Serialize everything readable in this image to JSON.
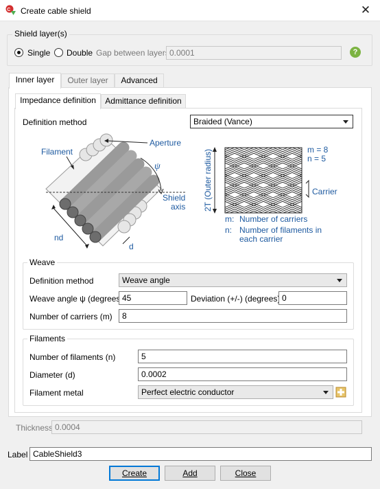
{
  "window": {
    "title": "Create cable shield",
    "app_icon": "cadfeko-icon",
    "close_label": "✕"
  },
  "shield_layers": {
    "group_label": "Shield layer(s)",
    "single_label": "Single",
    "double_label": "Double",
    "selected": "Single",
    "gap_label": "Gap between layers",
    "gap_value": "0.0001",
    "help_label": "?"
  },
  "layer_tabs": [
    {
      "label": "Inner layer",
      "selected": true
    },
    {
      "label": "Outer layer",
      "selected": false
    },
    {
      "label": "Advanced",
      "selected": false
    }
  ],
  "def_tabs": [
    {
      "label": "Impedance definition",
      "selected": true
    },
    {
      "label": "Admittance definition",
      "selected": false
    }
  ],
  "definition_method": {
    "label": "Definition method",
    "value": "Braided (Vance)"
  },
  "diagram": {
    "left": {
      "filament": "Filament",
      "aperture": "Aperture",
      "psi": "ψ",
      "shield_axis_1": "Shield",
      "shield_axis_2": "axis",
      "nd": "nd",
      "d": "d"
    },
    "right": {
      "vertical_label": "2T (Outer radius)",
      "m_eq": "m = 8",
      "n_eq": "n = 5",
      "carrier": "Carrier",
      "m_key": "m:",
      "m_desc": "Number of carriers",
      "n_key": "n:",
      "n_desc_1": "Number of filaments in",
      "n_desc_2": "each carrier"
    },
    "text_color": "#1e5aa0"
  },
  "weave": {
    "group_label": "Weave",
    "method_label": "Definition method",
    "method_value": "Weave angle",
    "angle_label": "Weave angle ψ (degrees)",
    "angle_value": "45",
    "deviation_label": "Deviation (+/-) (degrees)",
    "deviation_value": "0",
    "carriers_label": "Number of carriers (m)",
    "carriers_value": "8"
  },
  "filaments": {
    "group_label": "Filaments",
    "count_label": "Number of filaments (n)",
    "count_value": "5",
    "diameter_label": "Diameter (d)",
    "diameter_value": "0.0002",
    "metal_label": "Filament metal",
    "metal_value": "Perfect electric conductor",
    "add_metal_icon": "add-metal-icon"
  },
  "thickness": {
    "label": "Thickness",
    "value": "0.0004"
  },
  "label_field": {
    "label": "Label",
    "value": "CableShield3"
  },
  "buttons": {
    "create": "Create",
    "add": "Add",
    "close": "Close"
  }
}
